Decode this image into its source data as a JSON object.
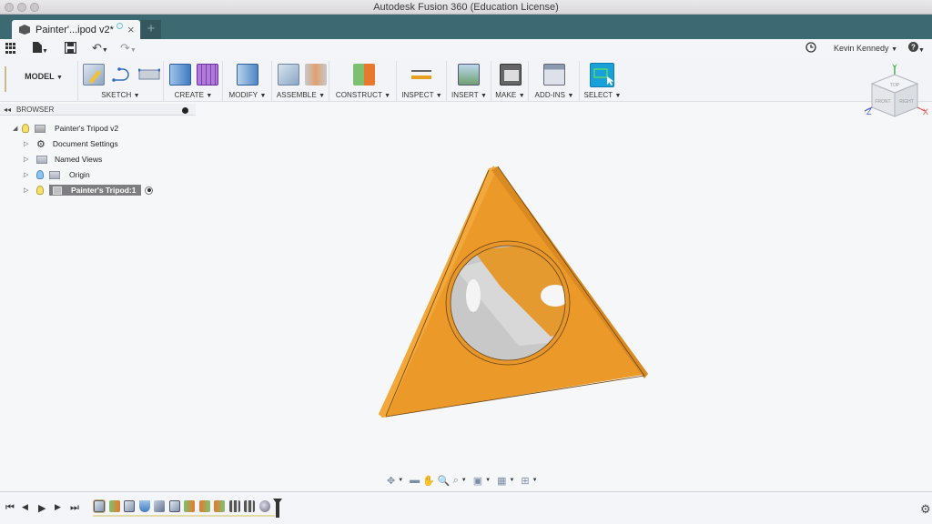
{
  "window": {
    "title": "Autodesk Fusion 360 (Education License)"
  },
  "tabs": [
    {
      "label": "Painter'...ipod v2*",
      "close": "×"
    }
  ],
  "new_tab": "+",
  "qat": {
    "apps_icon": "grid-icon",
    "file_icon": "file-icon",
    "save_icon": "save-icon",
    "undo_icon": "undo-icon",
    "redo_icon": "redo-icon",
    "job_status_icon": "clock-icon",
    "user_name": "Kevin Kennedy",
    "help_icon": "help-icon"
  },
  "ribbon": {
    "workspace": "MODEL",
    "groups": [
      {
        "label": "SKETCH",
        "icons": [
          "create-sketch-icon",
          "spline-icon",
          "stop-sketch-icon"
        ]
      },
      {
        "label": "CREATE",
        "icons": [
          "extrude-icon",
          "create-form-icon"
        ]
      },
      {
        "label": "MODIFY",
        "icons": [
          "press-pull-icon"
        ]
      },
      {
        "label": "ASSEMBLE",
        "icons": [
          "new-component-icon",
          "joint-icon"
        ]
      },
      {
        "label": "CONSTRUCT",
        "icons": [
          "offset-plane-icon"
        ]
      },
      {
        "label": "INSPECT",
        "icons": [
          "measure-icon"
        ]
      },
      {
        "label": "INSERT",
        "icons": [
          "insert-image-icon"
        ]
      },
      {
        "label": "MAKE",
        "icons": [
          "3d-print-icon"
        ]
      },
      {
        "label": "ADD-INS",
        "icons": [
          "scripts-icon"
        ]
      },
      {
        "label": "SELECT",
        "icons": [
          "select-icon"
        ]
      }
    ]
  },
  "browser": {
    "title": "BROWSER",
    "items": [
      {
        "label": "Painter's Tripod v2",
        "level": 0,
        "expanded": true
      },
      {
        "label": "Document Settings",
        "level": 1
      },
      {
        "label": "Named Views",
        "level": 1
      },
      {
        "label": "Origin",
        "level": 1
      },
      {
        "label": "Painter's Tripod:1",
        "level": 1,
        "selected": true
      }
    ]
  },
  "viewcube": {
    "faces": [
      "TOP",
      "FRONT",
      "RIGHT"
    ],
    "axes": [
      "Y",
      "Z",
      "X"
    ]
  },
  "navbar": {
    "icons": [
      "orbit-icon",
      "look-at-icon",
      "pan-icon",
      "zoom-icon",
      "zoom-window-icon",
      "display-settings-icon",
      "grid-settings-icon",
      "viewports-icon"
    ]
  },
  "timeline": {
    "controls": [
      "⏮",
      "◀",
      "▶",
      "▶",
      "⏭"
    ],
    "features": [
      "sketch",
      "extrude",
      "sketch",
      "fillet",
      "box",
      "sketch",
      "extrude",
      "combine",
      "combine",
      "pattern",
      "pattern",
      "sphere"
    ]
  },
  "colors": {
    "model": "#f0a030",
    "accent": "#1aa0d8",
    "tabbar": "#3d6a72"
  }
}
